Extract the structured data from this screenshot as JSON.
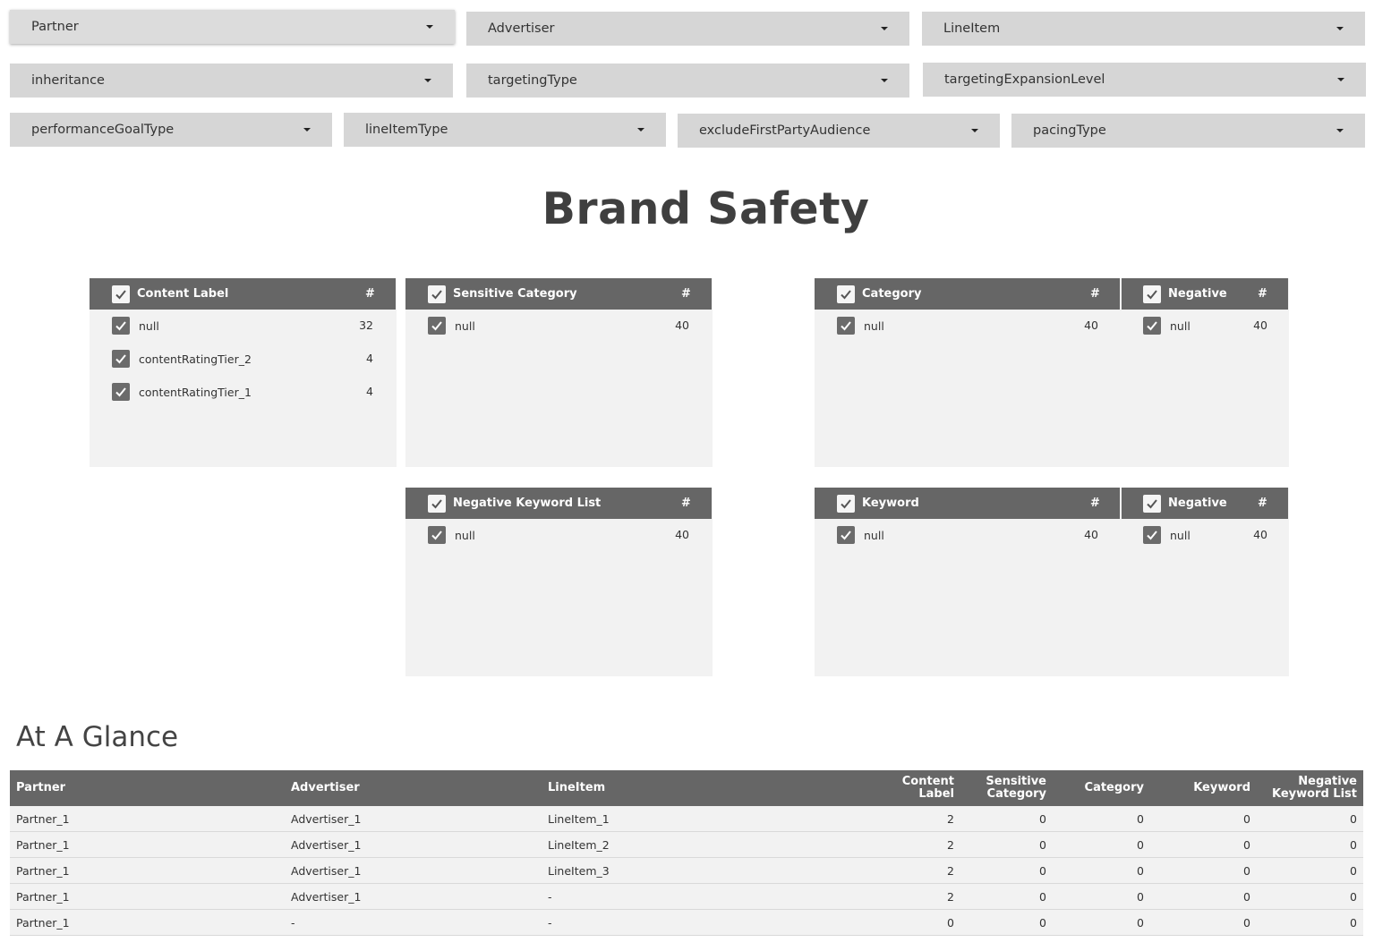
{
  "filters": {
    "partner": "Partner",
    "advertiser": "Advertiser",
    "lineitem": "LineItem",
    "inheritance": "inheritance",
    "targeting_type": "targetingType",
    "targeting_expansion_level": "targetingExpansionLevel",
    "performance_goal_type": "performanceGoalType",
    "line_item_type": "lineItemType",
    "exclude_first_party_audience": "excludeFirstPartyAudience",
    "pacing_type": "pacingType"
  },
  "page_title": "Brand Safety",
  "panels": {
    "content_label": {
      "header": "Content Label",
      "hash": "#",
      "rows": [
        {
          "label": "null",
          "count": "32"
        },
        {
          "label": "contentRatingTier_2",
          "count": "4"
        },
        {
          "label": "contentRatingTier_1",
          "count": "4"
        }
      ]
    },
    "sensitive_category": {
      "header": "Sensitive Category",
      "hash": "#",
      "rows": [
        {
          "label": "null",
          "count": "40"
        }
      ]
    },
    "category": {
      "header": "Category",
      "hash": "#",
      "rows": [
        {
          "label": "null",
          "count": "40"
        }
      ]
    },
    "category_negative": {
      "header": "Negative",
      "hash": "#",
      "rows": [
        {
          "label": "null",
          "count": "40"
        }
      ]
    },
    "negative_keyword_list": {
      "header": "Negative Keyword List",
      "hash": "#",
      "rows": [
        {
          "label": "null",
          "count": "40"
        }
      ]
    },
    "keyword": {
      "header": "Keyword",
      "hash": "#",
      "rows": [
        {
          "label": "null",
          "count": "40"
        }
      ]
    },
    "keyword_negative": {
      "header": "Negative",
      "hash": "#",
      "rows": [
        {
          "label": "null",
          "count": "40"
        }
      ]
    }
  },
  "glance": {
    "title": "At A Glance",
    "columns": {
      "partner": "Partner",
      "advertiser": "Advertiser",
      "lineitem": "LineItem",
      "content_label_1": "Content",
      "content_label_2": "Label",
      "sensitive_category_1": "Sensitive",
      "sensitive_category_2": "Category",
      "category": "Category",
      "keyword": "Keyword",
      "negative_keyword_list_1": "Negative",
      "negative_keyword_list_2": "Keyword List"
    },
    "rows": [
      [
        "Partner_1",
        "Advertiser_1",
        "LineItem_1",
        "2",
        "0",
        "0",
        "0",
        "0"
      ],
      [
        "Partner_1",
        "Advertiser_1",
        "LineItem_2",
        "2",
        "0",
        "0",
        "0",
        "0"
      ],
      [
        "Partner_1",
        "Advertiser_1",
        "LineItem_3",
        "2",
        "0",
        "0",
        "0",
        "0"
      ],
      [
        "Partner_1",
        "Advertiser_1",
        "-",
        "2",
        "0",
        "0",
        "0",
        "0"
      ],
      [
        "Partner_1",
        "-",
        "-",
        "0",
        "0",
        "0",
        "0",
        "0"
      ]
    ]
  }
}
